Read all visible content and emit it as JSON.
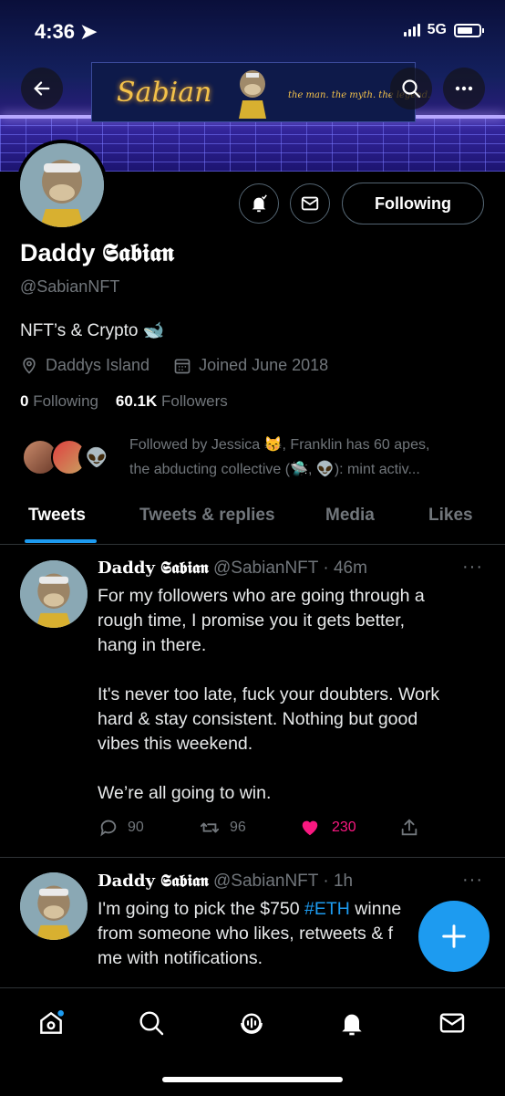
{
  "status_bar": {
    "time": "4:36",
    "network": "5G"
  },
  "banner": {
    "sign_name": "Sabian",
    "sign_tagline": "the man. the myth. the legend."
  },
  "profile": {
    "display_name_prefix": "Daddy",
    "display_name_styled": "𝕾𝖆𝖇𝖎𝖆𝖓",
    "handle": "@SabianNFT",
    "bio": "NFT’s & Crypto 🐋",
    "location": "Daddys Island",
    "joined": "Joined June 2018",
    "following_count": "0",
    "following_label": "Following",
    "followers_count": "60.1K",
    "followers_label": "Followers",
    "following_button": "Following",
    "followed_by_line1": "Followed by Jessica 😽, Franklin has 60 apes,",
    "followed_by_line2": "the abducting collective (🛸, 👽): mint activ..."
  },
  "tabs": [
    {
      "label": "Tweets",
      "active": true
    },
    {
      "label": "Tweets & replies",
      "active": false
    },
    {
      "label": "Media",
      "active": false
    },
    {
      "label": "Likes",
      "active": false
    }
  ],
  "tweets": [
    {
      "name": "Daddy 𝕾𝖆𝖇𝖎𝖆𝖓",
      "handle": "@SabianNFT",
      "time": "46m",
      "body_lines": [
        "For my followers who are going through a",
        "rough time, I promise you it gets better,",
        "hang in there.",
        "",
        "It's never too late, fuck your doubters. Work",
        "hard & stay consistent. Nothing but good",
        "vibes this weekend.",
        "",
        "We’re all going to win."
      ],
      "replies": "90",
      "retweets": "96",
      "likes": "230",
      "liked": true
    },
    {
      "name": "Daddy 𝕾𝖆𝖇𝖎𝖆𝖓",
      "handle": "@SabianNFT",
      "time": "1h",
      "line1_prefix": "I'm going to pick the $750 ",
      "line1_hashtag": "#ETH",
      "line1_suffix": " winne",
      "line2": "from someone who likes, retweets & f",
      "line3": "me with notifications."
    }
  ],
  "colors": {
    "accent": "#1d9bf0",
    "like": "#f91880",
    "muted": "#71767b",
    "background": "#000000"
  },
  "icons": {
    "back": "arrow-left-icon",
    "search": "search-icon",
    "more": "more-icon",
    "notify": "bell-icon",
    "message": "mail-icon",
    "compose": "plus-icon"
  }
}
